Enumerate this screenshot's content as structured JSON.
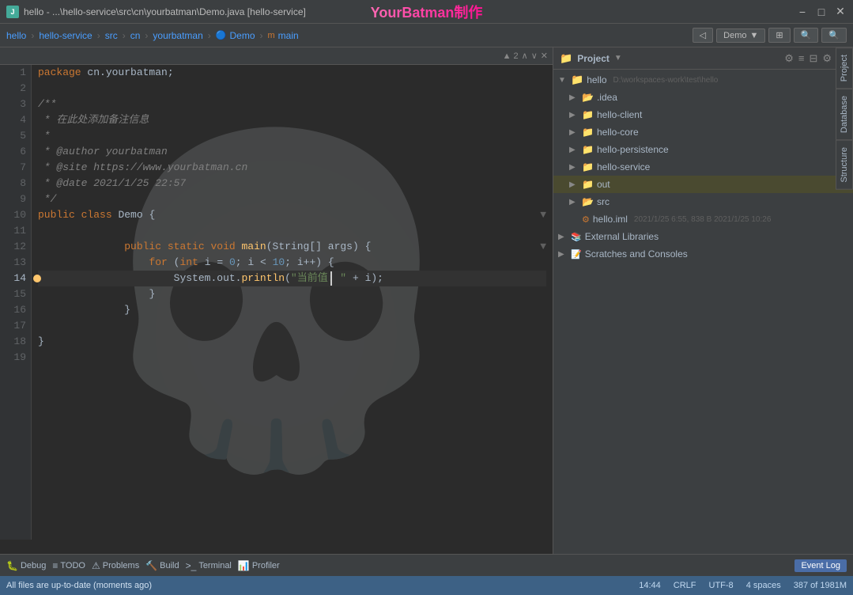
{
  "titlebar": {
    "app_name": "hello",
    "file_path": "...\\hello-service\\src\\cn\\yourbatman\\Demo.java [hello-service]",
    "watermark": "YourBatman制作",
    "min_label": "−",
    "max_label": "□",
    "close_label": "✕"
  },
  "navbar": {
    "crumbs": [
      "hello",
      "hello-service",
      "src",
      "cn",
      "yourbatman",
      "Demo",
      "main"
    ],
    "demo_btn": "Demo",
    "nav_icons": [
      "◁",
      "⊞",
      "🔍"
    ]
  },
  "editor": {
    "toolbar": {
      "warning_count": "▲ 2",
      "up_arrow": "∧",
      "down_arrow": "∨",
      "close": "✕"
    },
    "lines": [
      {
        "num": 1,
        "content": "package cn.yourbatman;",
        "type": "package"
      },
      {
        "num": 2,
        "content": ""
      },
      {
        "num": 3,
        "content": "/**"
      },
      {
        "num": 4,
        "content": " * 在此处添加备注信息"
      },
      {
        "num": 5,
        "content": " *"
      },
      {
        "num": 6,
        "content": " * @author yourbatman"
      },
      {
        "num": 7,
        "content": " * @site https://www.yourbatman.cn"
      },
      {
        "num": 8,
        "content": " * @date 2021/1/25 22:57"
      },
      {
        "num": 9,
        "content": " */"
      },
      {
        "num": 10,
        "content": "public class Demo {"
      },
      {
        "num": 11,
        "content": ""
      },
      {
        "num": 12,
        "content": "    public static void main(String[] args) {"
      },
      {
        "num": 13,
        "content": "        for (int i = 0; i < 10; i++) {"
      },
      {
        "num": 14,
        "content": "            System.out.println(\"当前值: \" + i);",
        "active": true,
        "debug": true
      },
      {
        "num": 15,
        "content": "        }"
      },
      {
        "num": 16,
        "content": "    }"
      },
      {
        "num": 17,
        "content": ""
      },
      {
        "num": 18,
        "content": "}"
      },
      {
        "num": 19,
        "content": ""
      }
    ]
  },
  "project_panel": {
    "title": "Project",
    "dropdown": "▼",
    "root": {
      "name": "hello",
      "path": "D:\\workspaces-work\\test\\hello"
    },
    "items": [
      {
        "id": "idea",
        "label": ".idea",
        "indent": 1,
        "type": "folder",
        "collapsed": true
      },
      {
        "id": "hello-client",
        "label": "hello-client",
        "indent": 1,
        "type": "module",
        "collapsed": true
      },
      {
        "id": "hello-core",
        "label": "hello-core",
        "indent": 1,
        "type": "module",
        "collapsed": true
      },
      {
        "id": "hello-persistence",
        "label": "hello-persistence",
        "indent": 1,
        "type": "module",
        "collapsed": true
      },
      {
        "id": "hello-service",
        "label": "hello-service",
        "indent": 1,
        "type": "module",
        "collapsed": true
      },
      {
        "id": "out",
        "label": "out",
        "indent": 1,
        "type": "folder-yellow",
        "collapsed": true,
        "highlighted": true
      },
      {
        "id": "src",
        "label": "src",
        "indent": 1,
        "type": "folder",
        "collapsed": true
      },
      {
        "id": "hello-iml",
        "label": "hello.iml",
        "indent": 1,
        "type": "iml",
        "meta": "2021/1/25 6:55, 838 B 2021/1/25 10:26"
      },
      {
        "id": "external-libraries",
        "label": "External Libraries",
        "indent": 0,
        "type": "library",
        "collapsed": true
      },
      {
        "id": "scratches",
        "label": "Scratches and Consoles",
        "indent": 0,
        "type": "scratches",
        "collapsed": true
      }
    ],
    "actions": [
      "⚙",
      "≡",
      "⊟",
      "⚙",
      "—"
    ]
  },
  "right_tabs": [
    {
      "id": "project-tab",
      "label": "Project"
    },
    {
      "id": "database-tab",
      "label": "Database"
    },
    {
      "id": "structure-tab",
      "label": "Structure"
    }
  ],
  "bottom_toolbar": {
    "tabs": [
      {
        "id": "debug",
        "label": "Debug",
        "icon": "🐛"
      },
      {
        "id": "todo",
        "label": "TODO",
        "icon": "≡"
      },
      {
        "id": "problems",
        "label": "Problems",
        "icon": "⚠"
      },
      {
        "id": "build",
        "label": "Build",
        "icon": "🔨"
      },
      {
        "id": "terminal",
        "label": "Terminal",
        "icon": ">_"
      },
      {
        "id": "profiler",
        "label": "Profiler",
        "icon": "📊"
      }
    ],
    "event_log": "Event Log"
  },
  "status_bar": {
    "message": "All files are up-to-date (moments ago)",
    "time": "14:44",
    "line_endings": "CRLF",
    "encoding": "UTF-8",
    "indent": "4 spaces",
    "position": "387 of 1981M"
  }
}
